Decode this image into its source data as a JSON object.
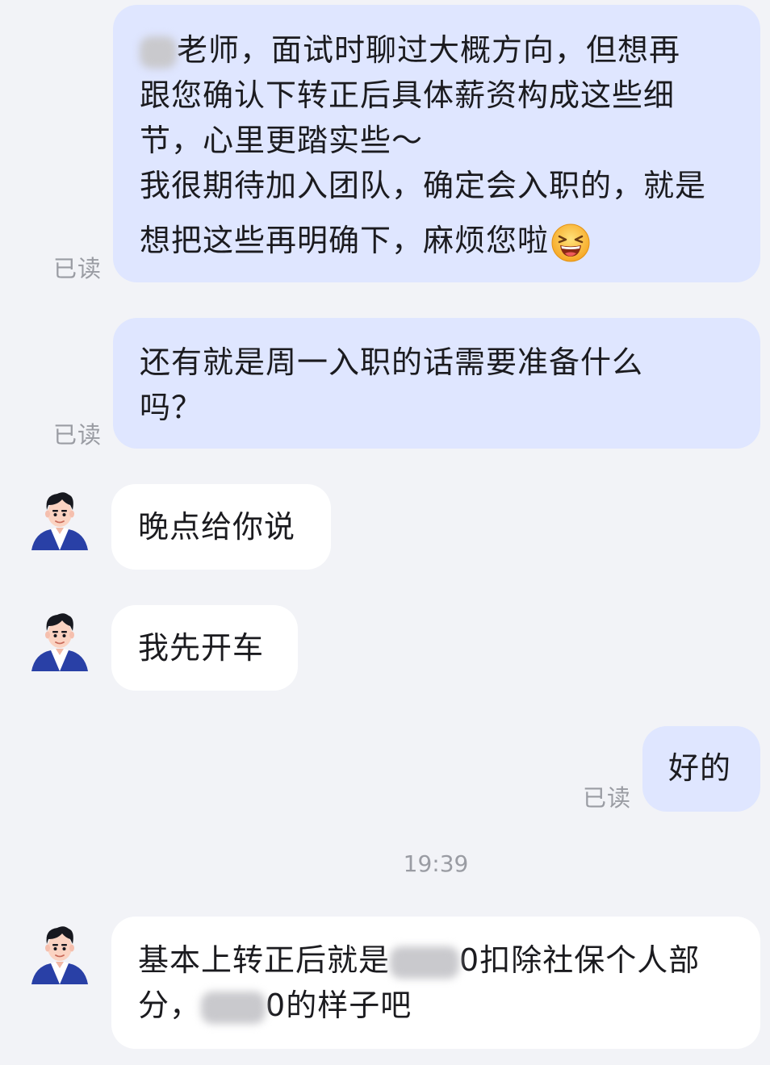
{
  "messages": [
    {
      "id": "m1",
      "direction": "out",
      "lines": [
        "老师，面试时聊过大概方向，但想再",
        "跟您确认下转正后具体薪资构成这些细",
        "节，心里更踏实些～",
        "我很期待加入团队，确定会入职的，就是",
        "想把这些再明确下，麻烦您啦"
      ],
      "read_label": "已读",
      "redacted_prefix": "某",
      "emoji": "grinning-squint-face-icon"
    },
    {
      "id": "m2",
      "direction": "out",
      "lines": [
        "还有就是周一入职的话需要准备什么",
        "吗？"
      ],
      "read_label": "已读"
    },
    {
      "id": "m3",
      "direction": "in",
      "lines": [
        "晚点给你说"
      ]
    },
    {
      "id": "m4",
      "direction": "in",
      "lines": [
        "我先开车"
      ]
    },
    {
      "id": "m5",
      "direction": "out",
      "lines": [
        "好的"
      ],
      "read_label": "已读"
    },
    {
      "id": "m6",
      "direction": "in",
      "line1_a": "基本上转正后就是",
      "line1_redacted": "4000",
      "line1_b": "0扣除社保个人部",
      "line2_a": "分，",
      "line2_redacted": "3700",
      "line2_b": "0的样子吧"
    }
  ],
  "timestamp": "19:39",
  "colors": {
    "background": "#f2f3f7",
    "outgoing_bubble": "#dfe6ff",
    "incoming_bubble": "#ffffff",
    "read_text": "#9a9ca3"
  },
  "avatar_icon": "man-avatar-icon"
}
